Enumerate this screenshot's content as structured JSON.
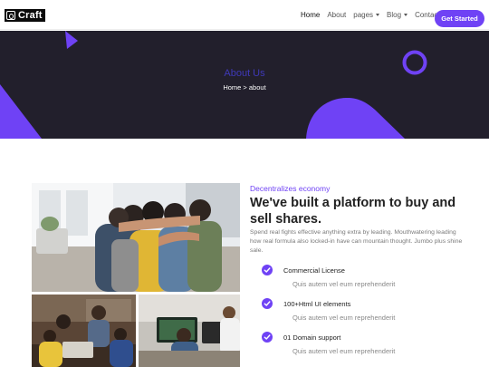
{
  "brand": {
    "name": "Craft"
  },
  "nav": {
    "items": [
      {
        "label": "Home",
        "active": true,
        "dropdown": false
      },
      {
        "label": "About",
        "active": false,
        "dropdown": false
      },
      {
        "label": "pages",
        "active": false,
        "dropdown": true
      },
      {
        "label": "Blog",
        "active": false,
        "dropdown": true
      },
      {
        "label": "Contact",
        "active": false,
        "dropdown": false
      }
    ],
    "cta_label": "Get Started"
  },
  "hero": {
    "title": "About Us",
    "breadcrumb": "Home > about"
  },
  "content": {
    "eyebrow": "Decentralizes economy",
    "headline": "We've built a platform to buy and sell shares.",
    "description": "Spend real fights effective anything extra by leading. Mouthwatering leading how real formula also locked-in have can mountain thought. Jumbo plus shine sale.",
    "features": [
      {
        "title": "Commercial License",
        "subtitle": "Quis autem vel eum reprehenderit"
      },
      {
        "title": "100+Html UI elements",
        "subtitle": "Quis autem vel eum reprehenderit"
      },
      {
        "title": "01 Domain support",
        "subtitle": "Quis autem vel eum reprehenderit"
      }
    ]
  },
  "colors": {
    "accent": "#6f42f5",
    "hero_bg": "#221f2c",
    "hero_title": "#3f39b8"
  },
  "icons": [
    "logo-mark-icon",
    "chevron-down-icon",
    "check-icon"
  ]
}
